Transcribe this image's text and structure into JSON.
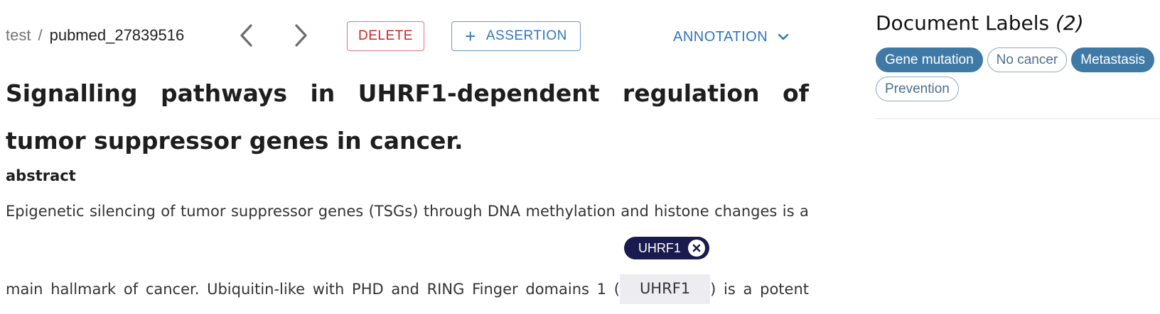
{
  "toolbar": {
    "breadcrumb": {
      "project": "test",
      "separator": "/",
      "document": "pubmed_27839516"
    },
    "delete_label": "DELETE",
    "assertion_label": "ASSERTION",
    "annotation_label": "ANNOTATION"
  },
  "document": {
    "title": "Signalling pathways in UHRF1-dependent regulation of tumor suppressor genes in cancer.",
    "section_heading": "abstract",
    "line1_words": [
      "Epigenetic",
      "silencing",
      "of",
      "tumor",
      "suppressor",
      "genes",
      "(TSGs)",
      "through",
      "DNA",
      "methylation",
      "and",
      "histone",
      "changes",
      "is",
      "a"
    ],
    "line2_before": [
      "main",
      "hallmark",
      "of",
      "cancer.",
      "Ubiquitin-like",
      "with",
      "PHD",
      "and",
      "RING",
      "Finger",
      "domains",
      "1",
      "("
    ],
    "entity": {
      "text": "UHRF1",
      "label": "UHRF1"
    },
    "line2_after": [
      ")",
      "is",
      "a",
      "potent"
    ]
  },
  "sidebar": {
    "title": "Document Labels",
    "count": "(2)",
    "labels": [
      {
        "name": "Gene mutation",
        "selected": true
      },
      {
        "name": "No cancer",
        "selected": false
      },
      {
        "name": "Metastasis",
        "selected": true
      },
      {
        "name": "Prevention",
        "selected": false
      }
    ]
  },
  "colors": {
    "accent": "#2f75bd",
    "danger": "#c62828",
    "chip_selected": "#3f7aa6",
    "entity_chip": "#1a1a4e",
    "entity_highlight": "#ececf1"
  }
}
